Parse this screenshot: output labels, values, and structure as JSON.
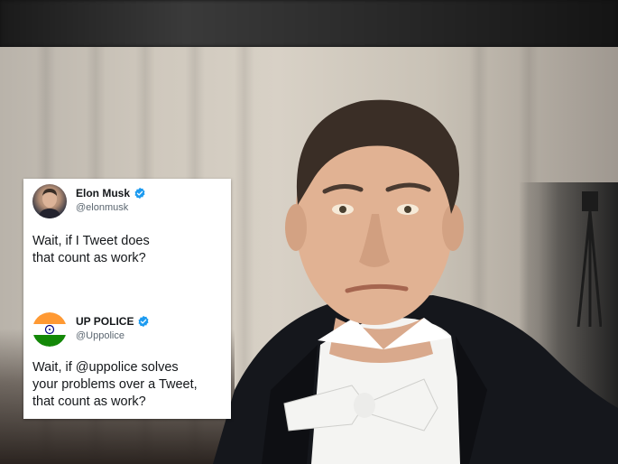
{
  "tweets": [
    {
      "display_name": "Elon Musk",
      "handle": "@elonmusk",
      "verified": true,
      "avatar_icon": "elon-musk-avatar",
      "text_lines": [
        "Wait, if I Tweet does",
        "that count as work?"
      ]
    },
    {
      "display_name": "UP POLICE",
      "handle": "@Uppolice",
      "verified": true,
      "avatar_icon": "indian-flag-avatar",
      "text_lines": [
        "Wait, if @uppolice solves",
        "your problems  over a Tweet,",
        "that count as work?"
      ]
    }
  ],
  "colors": {
    "verified_badge": "#1d9bf0",
    "suit": "#15171c",
    "bow_tie": "#f4f4f2",
    "flag_saffron": "#ff9933",
    "flag_green": "#138808",
    "flag_chakra": "#000080"
  }
}
